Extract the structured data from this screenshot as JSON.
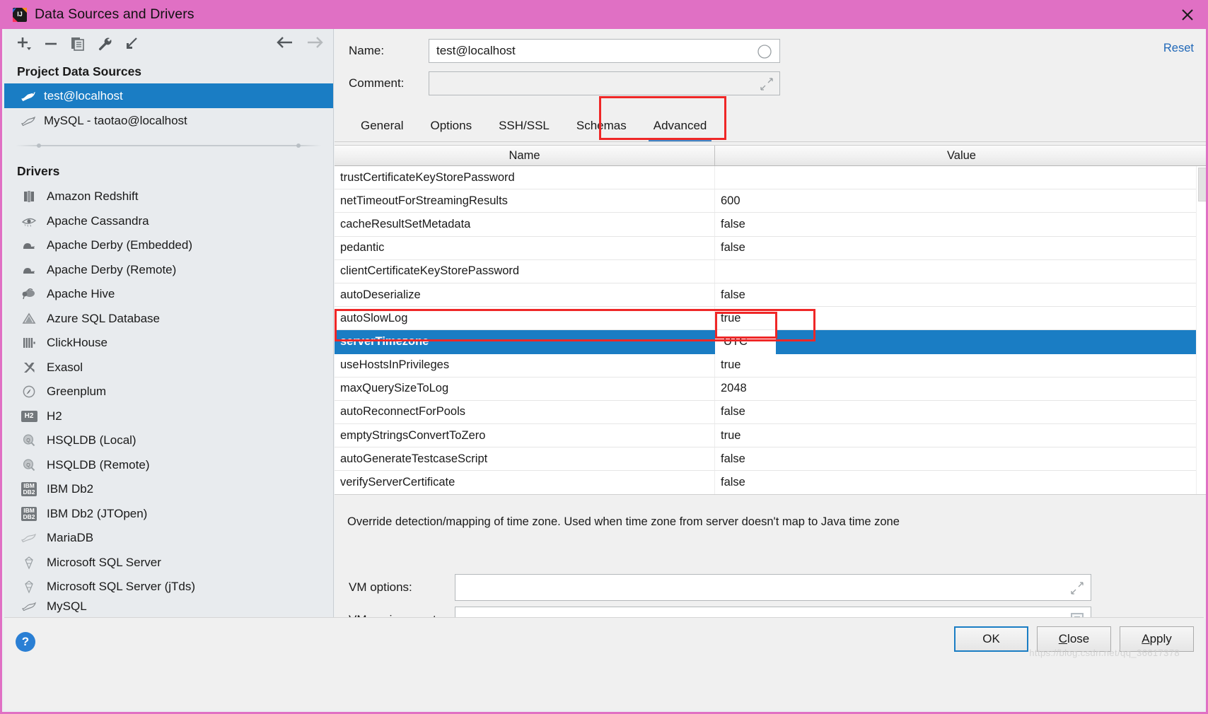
{
  "window": {
    "title": "Data Sources and Drivers",
    "logo_icon": "intellij-idea-logo-icon",
    "close_icon": "close-icon",
    "titlebar_color": "#e070c4"
  },
  "toolbar": {
    "buttons": [
      {
        "name": "add-button",
        "icon": "plus-icon"
      },
      {
        "name": "remove-button",
        "icon": "minus-icon"
      },
      {
        "name": "duplicate-button",
        "icon": "copy-icon"
      },
      {
        "name": "edit-driver-button",
        "icon": "wrench-icon"
      },
      {
        "name": "import-button",
        "icon": "import-arrow-icon"
      }
    ],
    "nav_back_icon": "arrow-left-icon",
    "nav_forward_icon": "arrow-right-icon"
  },
  "sidebar": {
    "project_sources_title": "Project Data Sources",
    "data_sources": [
      {
        "label": "test@localhost",
        "icon": "mysql-dolphin-icon",
        "selected": true
      },
      {
        "label": "MySQL - taotao@localhost",
        "icon": "mysql-dolphin-icon",
        "selected": false
      }
    ],
    "drivers_title": "Drivers",
    "drivers": [
      {
        "label": "Amazon Redshift",
        "icon": "redshift-icon"
      },
      {
        "label": "Apache Cassandra",
        "icon": "cassandra-eye-icon"
      },
      {
        "label": "Apache Derby (Embedded)",
        "icon": "derby-hat-icon"
      },
      {
        "label": "Apache Derby (Remote)",
        "icon": "derby-hat-icon"
      },
      {
        "label": "Apache Hive",
        "icon": "hive-bee-icon"
      },
      {
        "label": "Azure SQL Database",
        "icon": "azure-triangle-icon"
      },
      {
        "label": "ClickHouse",
        "icon": "clickhouse-bars-icon"
      },
      {
        "label": "Exasol",
        "icon": "exasol-x-icon"
      },
      {
        "label": "Greenplum",
        "icon": "greenplum-circle-icon"
      },
      {
        "label": "H2",
        "icon": "h2-badge-icon",
        "badge": "H2"
      },
      {
        "label": "HSQLDB (Local)",
        "icon": "hsqldb-magnifier-icon"
      },
      {
        "label": "HSQLDB (Remote)",
        "icon": "hsqldb-magnifier-icon"
      },
      {
        "label": "IBM Db2",
        "icon": "ibm-db2-badge-icon",
        "badge": "IBM|DB2"
      },
      {
        "label": "IBM Db2 (JTOpen)",
        "icon": "ibm-db2-badge-icon",
        "badge": "IBM|DB2"
      },
      {
        "label": "MariaDB",
        "icon": "mariadb-seal-icon"
      },
      {
        "label": "Microsoft SQL Server",
        "icon": "mssql-icon"
      },
      {
        "label": "Microsoft SQL Server (jTds)",
        "icon": "mssql-icon"
      },
      {
        "label": "MySQL",
        "icon": "mysql-dolphin-icon"
      }
    ]
  },
  "form": {
    "name_label": "Name:",
    "name_value": "test@localhost",
    "name_status_icon": "status-circle-icon",
    "comment_label": "Comment:",
    "comment_value": "",
    "comment_expand_icon": "expand-editor-icon",
    "reset_label": "Reset"
  },
  "tabs": {
    "items": [
      {
        "label": "General",
        "active": false
      },
      {
        "label": "Options",
        "active": false
      },
      {
        "label": "SSH/SSL",
        "active": false
      },
      {
        "label": "Schemas",
        "active": false
      },
      {
        "label": "Advanced",
        "active": true
      }
    ]
  },
  "table": {
    "columns": [
      "Name",
      "Value"
    ],
    "rows": [
      {
        "name": "trustCertificateKeyStorePassword",
        "value": "",
        "selected": false
      },
      {
        "name": "netTimeoutForStreamingResults",
        "value": "600",
        "selected": false
      },
      {
        "name": "cacheResultSetMetadata",
        "value": "false",
        "selected": false
      },
      {
        "name": "pedantic",
        "value": "false",
        "selected": false
      },
      {
        "name": "clientCertificateKeyStorePassword",
        "value": "",
        "selected": false
      },
      {
        "name": "autoDeserialize",
        "value": "false",
        "selected": false
      },
      {
        "name": "autoSlowLog",
        "value": "true",
        "selected": false
      },
      {
        "name": "serverTimezone",
        "value": "UTC",
        "selected": true
      },
      {
        "name": "useHostsInPrivileges",
        "value": "true",
        "selected": false
      },
      {
        "name": "maxQuerySizeToLog",
        "value": "2048",
        "selected": false
      },
      {
        "name": "autoReconnectForPools",
        "value": "false",
        "selected": false
      },
      {
        "name": "emptyStringsConvertToZero",
        "value": "true",
        "selected": false
      },
      {
        "name": "autoGenerateTestcaseScript",
        "value": "false",
        "selected": false
      },
      {
        "name": "verifyServerCertificate",
        "value": "false",
        "selected": false
      }
    ]
  },
  "description": {
    "text": "Override detection/mapping of time zone. Used when time zone from server doesn't map to Java time zone"
  },
  "vm": {
    "options_label": "VM options:",
    "options_value": "",
    "options_icon": "expand-editor-icon",
    "environment_label": "VM environment:",
    "environment_value": "",
    "environment_icon": "list-editor-icon"
  },
  "footer": {
    "help_icon": "help-question-icon",
    "buttons": [
      {
        "label": "OK",
        "mnemonic": "",
        "primary": true
      },
      {
        "label": "Close",
        "mnemonic": "C",
        "primary": false
      },
      {
        "label": "Apply",
        "mnemonic": "A",
        "primary": false
      }
    ],
    "watermark": "https://blog.csdn.net/qq_36617378"
  },
  "annotations": {
    "tab_highlight_color": "#ef2727",
    "row_highlight_color": "#ef2727",
    "value_cell_highlight_color": "#ef2727"
  }
}
